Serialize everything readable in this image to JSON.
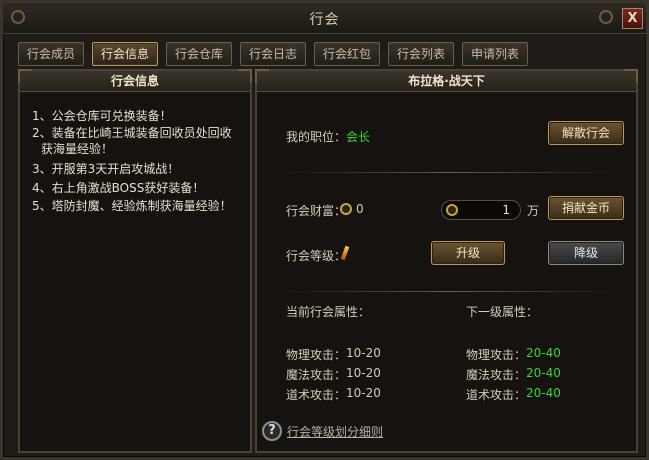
{
  "window": {
    "title": "行会",
    "close_label": "X"
  },
  "tabs": [
    {
      "label": "行会成员",
      "active": false
    },
    {
      "label": "行会信息",
      "active": true
    },
    {
      "label": "行会仓库",
      "active": false
    },
    {
      "label": "行会日志",
      "active": false
    },
    {
      "label": "行会红包",
      "active": false
    },
    {
      "label": "行会列表",
      "active": false
    },
    {
      "label": "申请列表",
      "active": false
    }
  ],
  "left_panel": {
    "title": "行会信息",
    "notices": [
      "1、公会仓库可兑换装备！",
      "2、装备在比崎王城装备回收员处回收",
      "获海量经验！",
      "3、开服第3天开启攻城战！",
      "4、右上角激战BOSS获好装备！",
      "5、塔防封魔、经验炼制获海量经验！"
    ]
  },
  "right_panel": {
    "title": "布拉格·战天下",
    "position_label": "我的职位：",
    "position_value": "会长",
    "dissolve_button": "解散行会",
    "wealth_label": "行会财富：",
    "wealth_value": "0",
    "donate_amount": "1",
    "donate_unit": "万",
    "donate_button": "捐献金币",
    "level_label": "行会等级：",
    "upgrade_button": "升级",
    "downgrade_button": "降级",
    "current_attrs_title": "当前行会属性：",
    "next_attrs_title": "下一级属性：",
    "current_attrs": [
      {
        "label": "物理攻击：",
        "value": "10-20"
      },
      {
        "label": "魔法攻击：",
        "value": "10-20"
      },
      {
        "label": "道术攻击：",
        "value": "10-20"
      }
    ],
    "next_attrs": [
      {
        "label": "物理攻击：",
        "value": "20-40"
      },
      {
        "label": "魔法攻击：",
        "value": "20-40"
      },
      {
        "label": "道术攻击：",
        "value": "20-40"
      }
    ],
    "help_icon_text": "?",
    "rules_link": "行会等级划分细则"
  },
  "colors": {
    "accent_green": "#39d43c",
    "gold_border": "#b8995b",
    "panel_bg": "#15120f"
  },
  "icons": [
    "gear-ornament-icon",
    "close-icon",
    "gold-coin-icon",
    "wand-icon",
    "help-icon"
  ]
}
